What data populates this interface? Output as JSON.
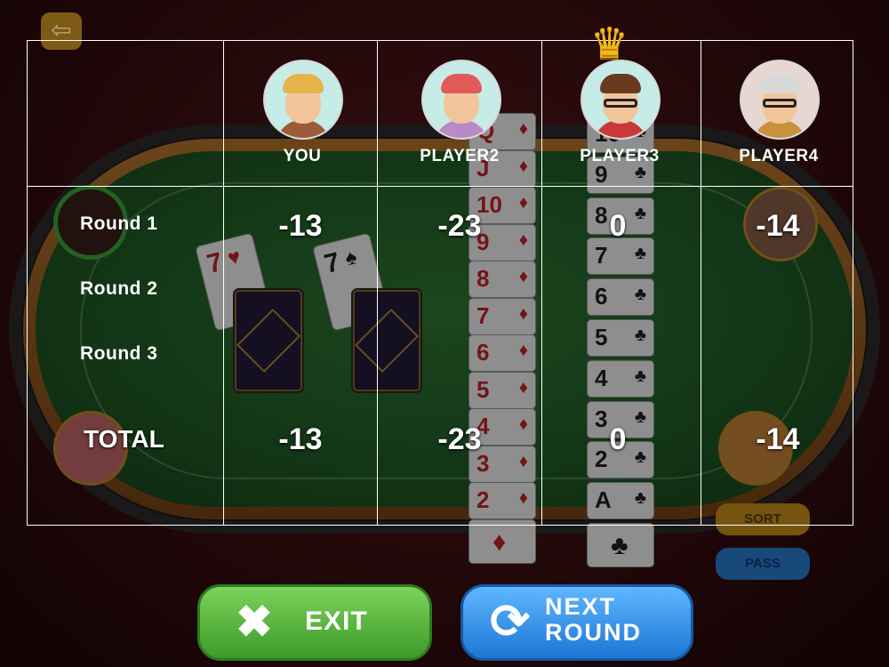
{
  "nav": {
    "back_icon": "arrow-left-icon"
  },
  "players": [
    {
      "name": "YOU",
      "round_scores": [
        "-13",
        "",
        ""
      ],
      "total": "-13"
    },
    {
      "name": "PLAYER2",
      "round_scores": [
        "-23",
        "",
        ""
      ],
      "total": "-23"
    },
    {
      "name": "PLAYER3",
      "round_scores": [
        "0",
        "",
        ""
      ],
      "total": "0",
      "leader": true
    },
    {
      "name": "PLAYER4",
      "round_scores": [
        "-14",
        "",
        ""
      ],
      "total": "-14"
    }
  ],
  "rounds": [
    "Round 1",
    "Round 2",
    "Round 3"
  ],
  "total_label": "TOTAL",
  "table": {
    "diamond_column": [
      "Q",
      "J",
      "10",
      "9",
      "8",
      "7",
      "6",
      "5",
      "4",
      "3",
      "2"
    ],
    "club_column": [
      "10",
      "9",
      "8",
      "7",
      "6",
      "5",
      "4",
      "3",
      "2",
      "A"
    ],
    "played_cards": [
      {
        "rank": "7",
        "suit": "♥"
      },
      {
        "rank": "7",
        "suit": "♠"
      }
    ]
  },
  "side_buttons": {
    "sort": "SORT",
    "pass": "PASS"
  },
  "buttons": {
    "exit": "EXIT",
    "next_line1": "NEXT",
    "next_line2": "ROUND"
  },
  "colors": {
    "felt": "#2f7a34",
    "exit_green": "#4caf35",
    "next_blue": "#2b8be8",
    "crown": "#f2b918"
  }
}
